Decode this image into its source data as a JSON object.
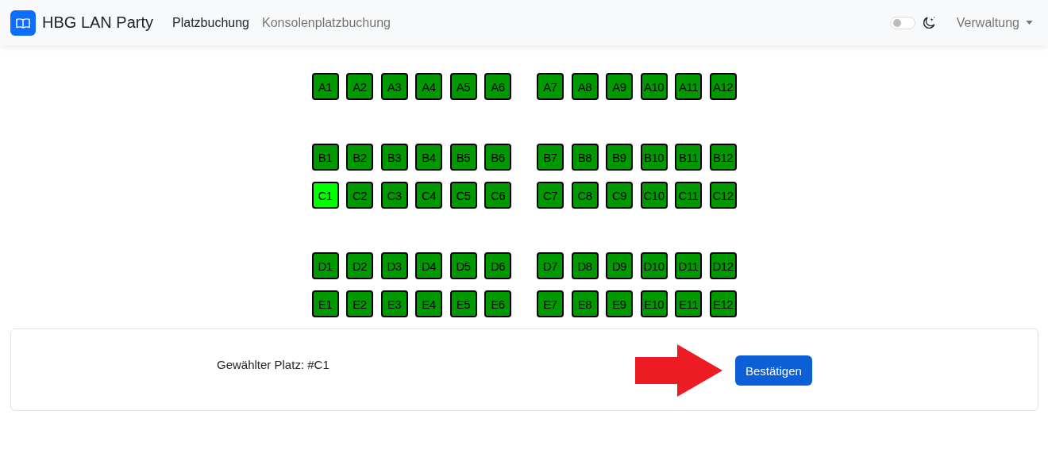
{
  "navbar": {
    "brand": "HBG LAN Party",
    "links": [
      {
        "label": "Platzbuchung",
        "selected": true
      },
      {
        "label": "Konsolenplatzbuchung",
        "selected": false
      }
    ],
    "dark_mode": {
      "on": false
    },
    "menu": {
      "label": "Verwaltung"
    }
  },
  "seat_blocks": [
    {
      "rows": [
        {
          "groups": [
            [
              {
                "label": "A1",
                "selected": false
              },
              {
                "label": "A2",
                "selected": false
              },
              {
                "label": "A3",
                "selected": false
              },
              {
                "label": "A4",
                "selected": false
              },
              {
                "label": "A5",
                "selected": false
              },
              {
                "label": "A6",
                "selected": false
              }
            ],
            [
              {
                "label": "A7",
                "selected": false
              },
              {
                "label": "A8",
                "selected": false
              },
              {
                "label": "A9",
                "selected": false
              },
              {
                "label": "A10",
                "selected": false
              },
              {
                "label": "A11",
                "selected": false
              },
              {
                "label": "A12",
                "selected": false
              }
            ]
          ]
        }
      ]
    },
    {
      "rows": [
        {
          "groups": [
            [
              {
                "label": "B1",
                "selected": false
              },
              {
                "label": "B2",
                "selected": false
              },
              {
                "label": "B3",
                "selected": false
              },
              {
                "label": "B4",
                "selected": false
              },
              {
                "label": "B5",
                "selected": false
              },
              {
                "label": "B6",
                "selected": false
              }
            ],
            [
              {
                "label": "B7",
                "selected": false
              },
              {
                "label": "B8",
                "selected": false
              },
              {
                "label": "B9",
                "selected": false
              },
              {
                "label": "B10",
                "selected": false
              },
              {
                "label": "B11",
                "selected": false
              },
              {
                "label": "B12",
                "selected": false
              }
            ]
          ]
        },
        {
          "groups": [
            [
              {
                "label": "C1",
                "selected": true
              },
              {
                "label": "C2",
                "selected": false
              },
              {
                "label": "C3",
                "selected": false
              },
              {
                "label": "C4",
                "selected": false
              },
              {
                "label": "C5",
                "selected": false
              },
              {
                "label": "C6",
                "selected": false
              }
            ],
            [
              {
                "label": "C7",
                "selected": false
              },
              {
                "label": "C8",
                "selected": false
              },
              {
                "label": "C9",
                "selected": false
              },
              {
                "label": "C10",
                "selected": false
              },
              {
                "label": "C11",
                "selected": false
              },
              {
                "label": "C12",
                "selected": false
              }
            ]
          ]
        }
      ]
    },
    {
      "rows": [
        {
          "groups": [
            [
              {
                "label": "D1",
                "selected": false
              },
              {
                "label": "D2",
                "selected": false
              },
              {
                "label": "D3",
                "selected": false
              },
              {
                "label": "D4",
                "selected": false
              },
              {
                "label": "D5",
                "selected": false
              },
              {
                "label": "D6",
                "selected": false
              }
            ],
            [
              {
                "label": "D7",
                "selected": false
              },
              {
                "label": "D8",
                "selected": false
              },
              {
                "label": "D9",
                "selected": false
              },
              {
                "label": "D10",
                "selected": false
              },
              {
                "label": "D11",
                "selected": false
              },
              {
                "label": "D12",
                "selected": false
              }
            ]
          ]
        },
        {
          "groups": [
            [
              {
                "label": "E1",
                "selected": false
              },
              {
                "label": "E2",
                "selected": false
              },
              {
                "label": "E3",
                "selected": false
              },
              {
                "label": "E4",
                "selected": false
              },
              {
                "label": "E5",
                "selected": false
              },
              {
                "label": "E6",
                "selected": false
              }
            ],
            [
              {
                "label": "E7",
                "selected": false
              },
              {
                "label": "E8",
                "selected": false
              },
              {
                "label": "E9",
                "selected": false
              },
              {
                "label": "E10",
                "selected": false
              },
              {
                "label": "E11",
                "selected": false
              },
              {
                "label": "E12",
                "selected": false
              }
            ]
          ]
        }
      ]
    }
  ],
  "selection": {
    "text": "Gewählter Platz: #C1",
    "button": "Bestätigen"
  }
}
